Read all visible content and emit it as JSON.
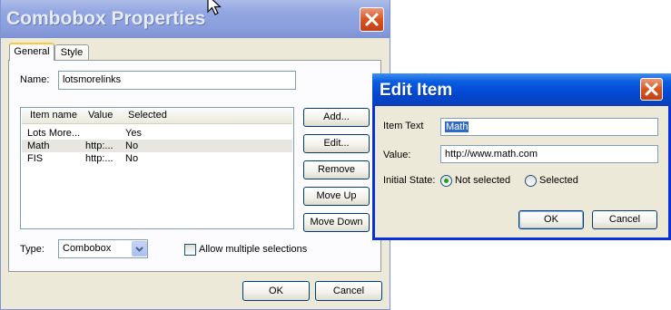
{
  "combobox_dialog": {
    "title": "Combobox Properties",
    "tabs": [
      {
        "label": "General"
      },
      {
        "label": "Style"
      }
    ],
    "name_label": "Name:",
    "name_value": "lotsmorelinks",
    "list_headers": [
      "Item name",
      "Value",
      "Selected"
    ],
    "rows": [
      {
        "name": "Lots More...",
        "value": "",
        "selected": "Yes"
      },
      {
        "name": "Math",
        "value": "http:...",
        "selected": "No"
      },
      {
        "name": "FIS",
        "value": "http:...",
        "selected": "No"
      }
    ],
    "side_buttons": {
      "add": "Add...",
      "edit": "Edit...",
      "remove": "Remove",
      "move_up": "Move Up",
      "move_down": "Move Down"
    },
    "type_label": "Type:",
    "type_value": "Combobox",
    "allow_multiple_label": "Allow multiple selections",
    "ok_label": "OK",
    "cancel_label": "Cancel"
  },
  "edit_item_dialog": {
    "title": "Edit Item",
    "item_text_label": "Item Text",
    "item_text_value": "Math",
    "value_label": "Value:",
    "value_value": "http://www.math.com",
    "initial_state_label": "Initial State:",
    "not_selected_label": "Not selected",
    "selected_label": "Selected",
    "initial_state": "Not selected",
    "ok_label": "OK",
    "cancel_label": "Cancel"
  },
  "colors": {
    "active_title": "#0348d4",
    "inactive_title": "#8b9fde",
    "dialog_bg": "#ece9d8",
    "close_button": "#d9541f"
  },
  "icons": [
    "close-icon",
    "mouse-cursor-icon",
    "dropdown-arrow-icon"
  ]
}
